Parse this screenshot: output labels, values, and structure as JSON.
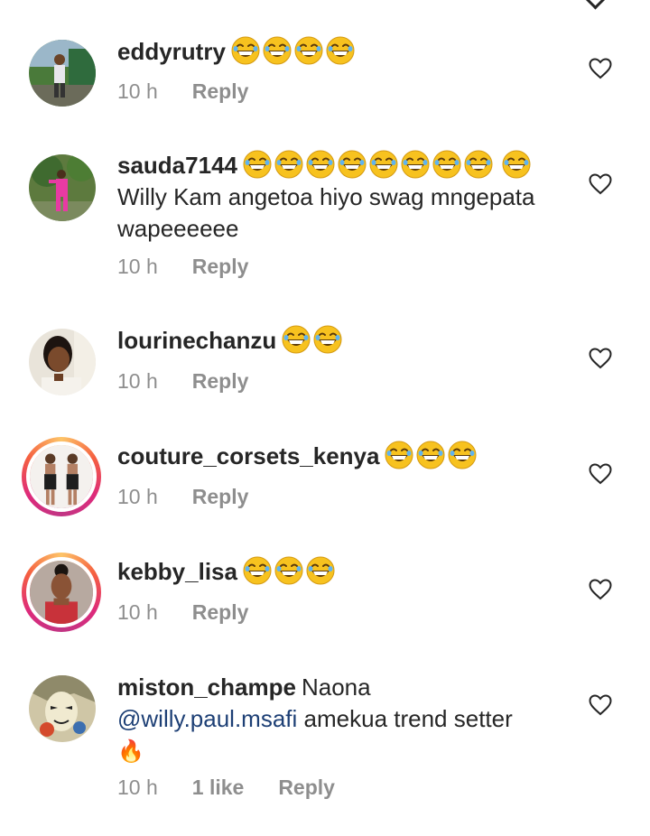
{
  "comments": [
    {
      "username": "eddyrutry",
      "text": "",
      "laugh_count": 4,
      "time": "10 h",
      "likes": "",
      "reply_label": "Reply"
    },
    {
      "username": "sauda7144",
      "text": "Willy Kam angetoa hiyo swag mngepata wapeeeeee",
      "laugh_count": 9,
      "time": "10 h",
      "likes": "",
      "reply_label": "Reply"
    },
    {
      "username": "lourinechanzu",
      "text": "",
      "laugh_count": 2,
      "time": "10 h",
      "likes": "",
      "reply_label": "Reply"
    },
    {
      "username": "couture_corsets_kenya",
      "text": "",
      "laugh_count": 3,
      "time": "10 h",
      "likes": "",
      "reply_label": "Reply"
    },
    {
      "username": "kebby_lisa",
      "text": "",
      "laugh_count": 3,
      "time": "10 h",
      "likes": "",
      "reply_label": "Reply"
    },
    {
      "username": "miston_champe",
      "text_before": "Naona",
      "mention": "@willy.paul.msafi",
      "text_after": "amekua trend setter",
      "trailing_emoji": "🔥",
      "time": "10 h",
      "likes": "1 like",
      "reply_label": "Reply"
    }
  ],
  "icons": {
    "laugh": "grinning-squinting-face-icon",
    "like": "heart-outline-icon",
    "collapse": "chevron-down-icon"
  },
  "colors": {
    "text": "#262626",
    "meta": "#8e8e8e",
    "mention": "#1d3f75",
    "story_ring": "#dd2a7b"
  }
}
